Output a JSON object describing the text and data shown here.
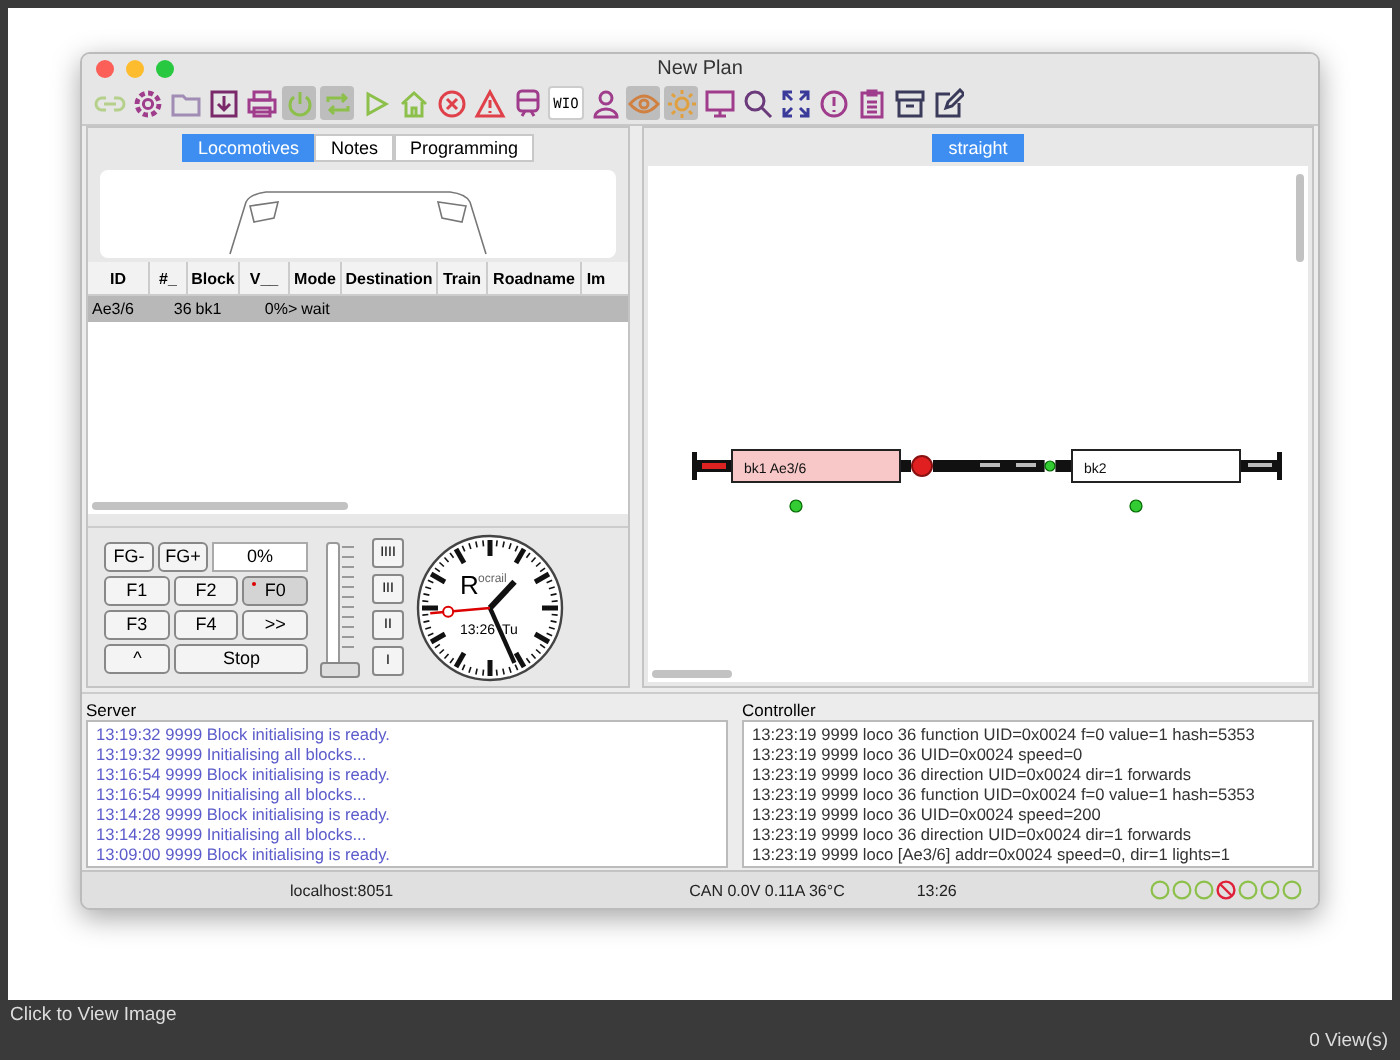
{
  "window": {
    "title": "New Plan"
  },
  "toolbar": [
    {
      "kind": "link",
      "on": false
    },
    {
      "kind": "gear",
      "on": false
    },
    {
      "kind": "folder",
      "on": false
    },
    {
      "kind": "download",
      "on": false
    },
    {
      "kind": "printer",
      "on": false
    },
    {
      "kind": "power",
      "on": true
    },
    {
      "kind": "loop",
      "on": true
    },
    {
      "kind": "play",
      "on": false
    },
    {
      "kind": "home",
      "on": false
    },
    {
      "kind": "x-circle",
      "on": false
    },
    {
      "kind": "warning",
      "on": false
    },
    {
      "kind": "train",
      "on": false
    },
    {
      "kind": "text",
      "label": "WIO",
      "on": false
    },
    {
      "kind": "person",
      "on": false
    },
    {
      "kind": "eye",
      "on": true
    },
    {
      "kind": "sun",
      "on": true
    },
    {
      "kind": "monitor",
      "on": false
    },
    {
      "kind": "search",
      "on": false
    },
    {
      "kind": "expand",
      "on": false
    },
    {
      "kind": "exclamation",
      "on": false
    },
    {
      "kind": "clipboard",
      "on": false
    },
    {
      "kind": "archive",
      "on": false
    },
    {
      "kind": "edit",
      "on": false
    }
  ],
  "left_tabs": [
    {
      "label": "Locomotives",
      "selected": true
    },
    {
      "label": "Notes",
      "selected": false
    },
    {
      "label": "Programming",
      "selected": false
    }
  ],
  "loco_table": {
    "columns": [
      "ID",
      "#_",
      "Block",
      "V__",
      "Mode",
      "Destination",
      "Train",
      "Roadname",
      "Im"
    ],
    "rows": [
      {
        "cells": [
          "Ae3/6",
          "36",
          "bk1",
          "0%>",
          "wait",
          "",
          "",
          "",
          ""
        ],
        "selected": true
      }
    ]
  },
  "throttle": {
    "rows": [
      [
        {
          "kind": "button",
          "label": "FG-"
        },
        {
          "kind": "button",
          "label": "FG+"
        },
        {
          "kind": "field",
          "label": "0%"
        }
      ],
      [
        {
          "kind": "function",
          "label": "F1",
          "on": false
        },
        {
          "kind": "function",
          "label": "F2",
          "on": false
        },
        {
          "kind": "function",
          "label": "F0",
          "on": true
        }
      ],
      [
        {
          "kind": "function",
          "label": "F3",
          "on": false
        },
        {
          "kind": "function",
          "label": "F4",
          "on": false
        },
        {
          "kind": "button",
          "label": ">>"
        }
      ],
      [
        {
          "kind": "button",
          "label": "^"
        },
        {
          "kind": "wide",
          "label": "Stop"
        }
      ]
    ],
    "speed": {
      "level": 0
    },
    "gears": [
      "IIII",
      "III",
      "II",
      "I"
    ],
    "clock": {
      "logo_initial": "R",
      "logo_rest": "ocrail",
      "time": "13:26",
      "day": "Tu"
    }
  },
  "plan_tabs": [
    {
      "label": "straight",
      "selected": true
    }
  ],
  "plan": {
    "blocks": [
      {
        "label": "bk1 Ae3/6",
        "occupied": true
      },
      {
        "label": "bk2",
        "occupied": false
      }
    ],
    "signal": {
      "stop": true
    }
  },
  "server": {
    "title": "Server",
    "lines": [
      "13:19:32 9999 Block initialising is ready.",
      "13:19:32 9999 Initialising all blocks...",
      "13:16:54 9999 Block initialising is ready.",
      "13:16:54 9999 Initialising all blocks...",
      "13:14:28 9999 Block initialising is ready.",
      "13:14:28 9999 Initialising all blocks...",
      "13:09:00 9999 Block initialising is ready."
    ]
  },
  "controller": {
    "title": "Controller",
    "lines": [
      "13:23:19 9999 loco 36 function UID=0x0024 f=0 value=1 hash=5353",
      "13:23:19 9999 loco 36 UID=0x0024 speed=0",
      "13:23:19 9999 loco 36 direction UID=0x0024 dir=1 forwards",
      "13:23:19 9999 loco 36 function UID=0x0024 f=0 value=1 hash=5353",
      "13:23:19 9999 loco 36 UID=0x0024 speed=200",
      "13:23:19 9999 loco 36 direction UID=0x0024 dir=1 forwards",
      "13:23:19 9999 loco [Ae3/6] addr=0x0024 speed=0, dir=1 lights=1"
    ]
  },
  "status_bar": {
    "host": "localhost:8051",
    "power": "CAN 0.0V 0.11A 36°C",
    "time": "13:26",
    "leds": [
      {
        "kind": "ok"
      },
      {
        "kind": "ok"
      },
      {
        "kind": "ok"
      },
      {
        "kind": "blocked"
      },
      {
        "kind": "ok"
      },
      {
        "kind": "ok"
      },
      {
        "kind": "ok"
      }
    ]
  },
  "footer": {
    "link": "Click to View Image",
    "views": "0 View(s)"
  }
}
